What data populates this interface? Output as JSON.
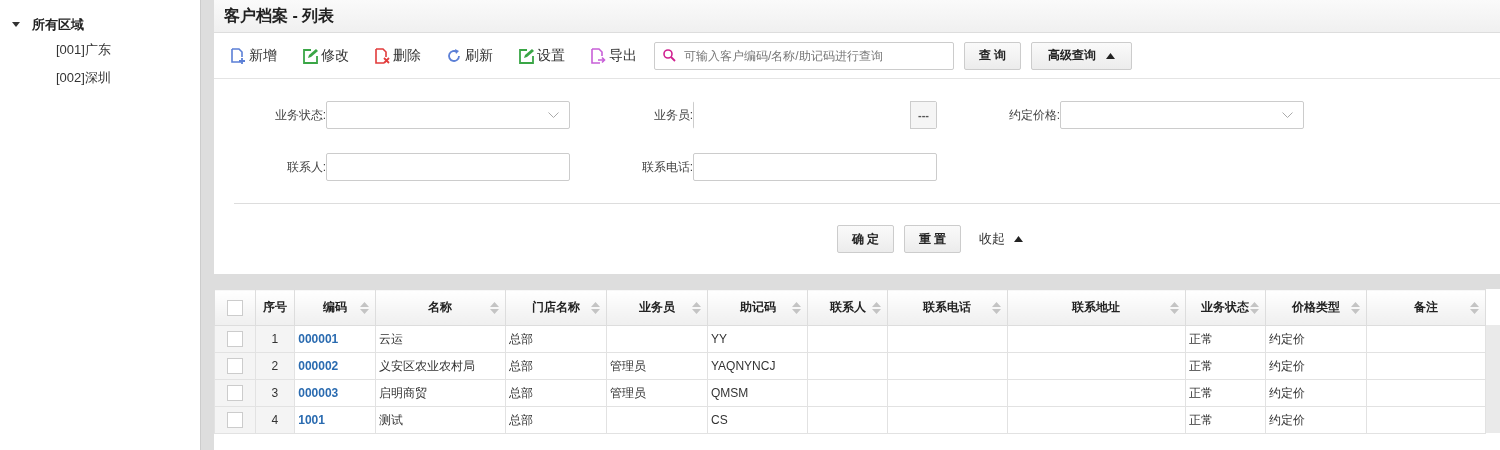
{
  "tree": {
    "label": "所有区域",
    "expanded": true,
    "children": [
      {
        "label": "[001]广东",
        "selected": false
      },
      {
        "label": "[002]深圳",
        "selected": false
      }
    ]
  },
  "window": {
    "title": "客户档案 - 列表"
  },
  "toolbar": {
    "buttons": [
      {
        "kind": "add",
        "label": "新增"
      },
      {
        "kind": "edit",
        "label": "修改"
      },
      {
        "kind": "delete",
        "label": "删除"
      },
      {
        "kind": "refresh",
        "label": "刷新"
      },
      {
        "kind": "settings",
        "label": "设置"
      },
      {
        "kind": "export",
        "label": "导出"
      }
    ],
    "search": {
      "placeholder": "可输入客户编码/名称/助记码进行查询"
    },
    "query_button": "查 询",
    "advanced_button": {
      "label": "高级查询",
      "expanded": true
    }
  },
  "filters": [
    {
      "kind": "select",
      "label": "业务状态:"
    },
    {
      "kind": "picker",
      "label": "业务员:",
      "button": "---"
    },
    {
      "kind": "select",
      "label": "约定价格:"
    },
    {
      "kind": "text",
      "label": "联系人:"
    },
    {
      "kind": "text",
      "label": "联系电话:"
    }
  ],
  "filter_actions": {
    "confirm": "确 定",
    "reset": "重 置",
    "collapse": "收起"
  },
  "table": {
    "header_checked": false,
    "columns": [
      {
        "label": "序号",
        "sortable": false
      },
      {
        "label": "编码",
        "sortable": true
      },
      {
        "label": "名称",
        "sortable": true
      },
      {
        "label": "门店名称",
        "sortable": true
      },
      {
        "label": "业务员",
        "sortable": true
      },
      {
        "label": "助记码",
        "sortable": true
      },
      {
        "label": "联系人",
        "sortable": true
      },
      {
        "label": "联系电话",
        "sortable": true
      },
      {
        "label": "联系地址",
        "sortable": true
      },
      {
        "label": "业务状态",
        "sortable": true
      },
      {
        "label": "价格类型",
        "sortable": true
      },
      {
        "label": "备注",
        "sortable": true
      }
    ],
    "rows": [
      {
        "checked": false,
        "cells": [
          "1",
          "000001",
          "云运",
          "总部",
          "",
          "YY",
          "",
          "",
          "",
          "正常",
          "约定价",
          ""
        ]
      },
      {
        "checked": false,
        "cells": [
          "2",
          "000002",
          "义安区农业农村局",
          "总部",
          "管理员",
          "YAQNYNCJ",
          "",
          "",
          "",
          "正常",
          "约定价",
          ""
        ]
      },
      {
        "checked": false,
        "cells": [
          "3",
          "000003",
          "启明商贸",
          "总部",
          "管理员",
          "QMSM",
          "",
          "",
          "",
          "正常",
          "约定价",
          ""
        ]
      },
      {
        "checked": false,
        "cells": [
          "4",
          "1001",
          "测试",
          "总部",
          "",
          "CS",
          "",
          "",
          "",
          "正常",
          "约定价",
          ""
        ]
      }
    ]
  }
}
